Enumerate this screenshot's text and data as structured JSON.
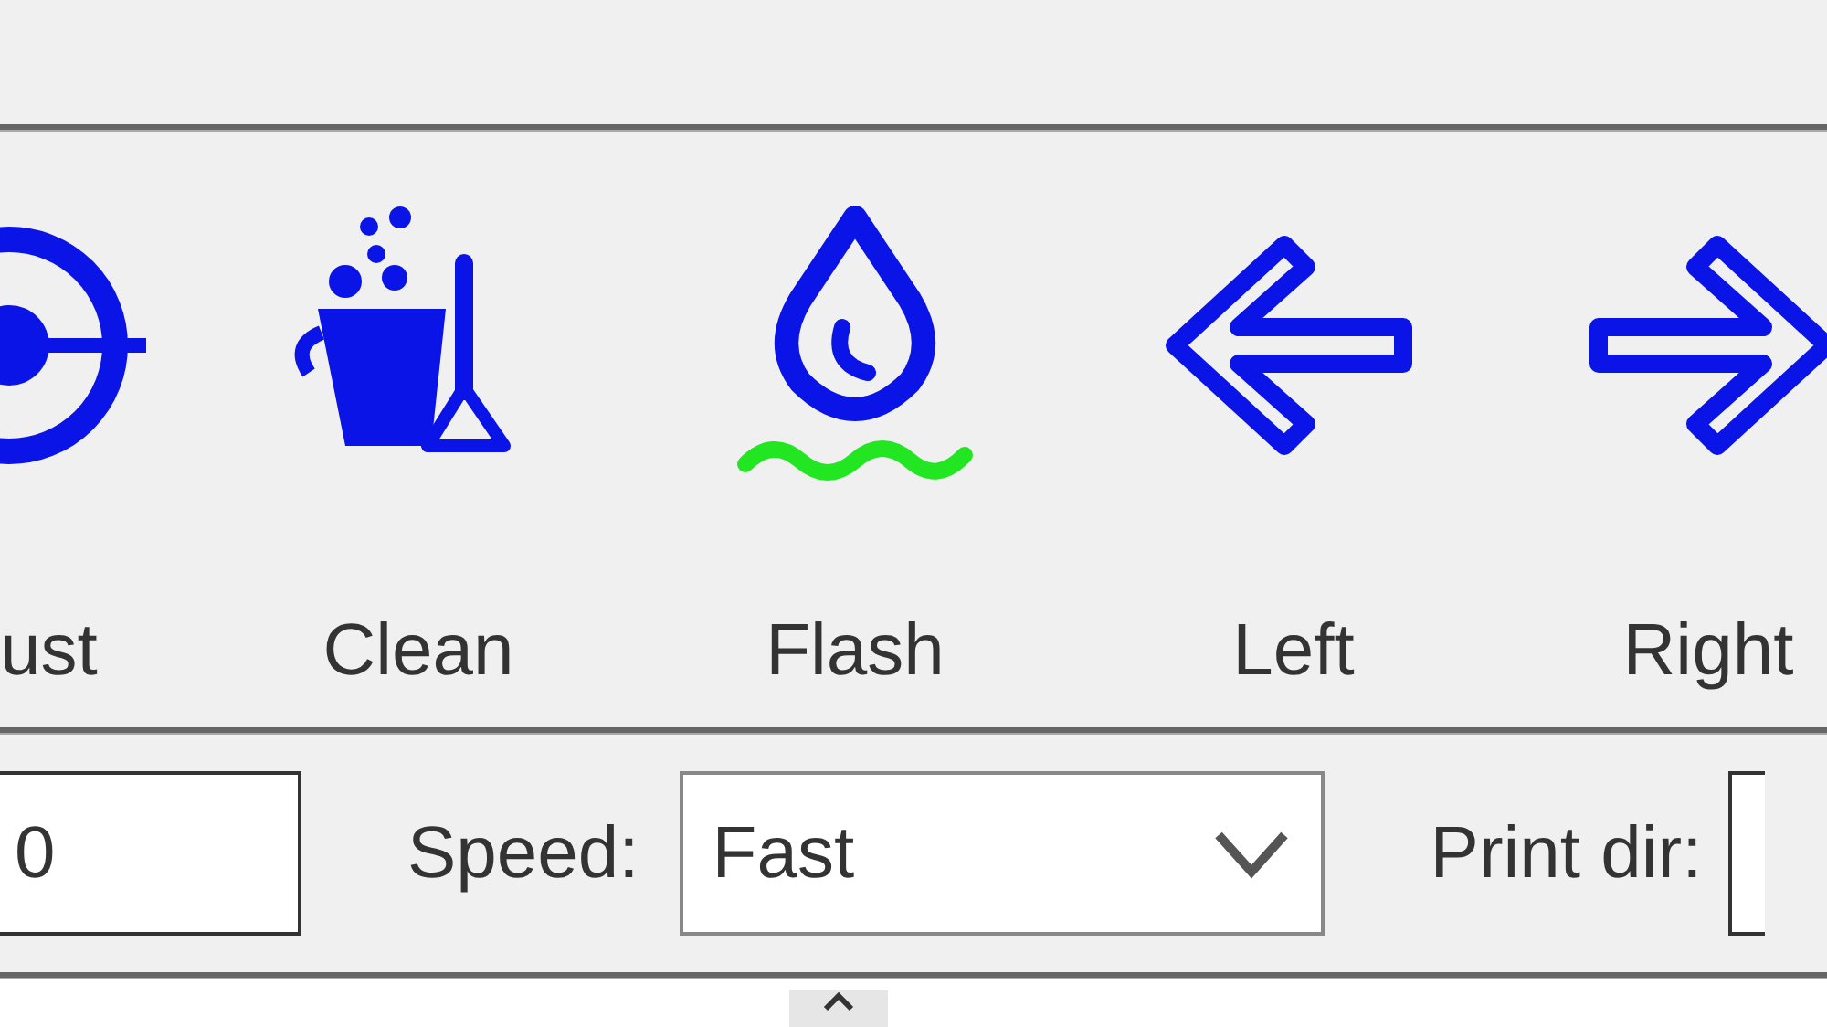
{
  "toolbar": {
    "buttons": [
      {
        "kind": "target",
        "label": "ust"
      },
      {
        "kind": "clean",
        "label": "Clean"
      },
      {
        "kind": "flash",
        "label": "Flash"
      },
      {
        "kind": "left",
        "label": "Left"
      },
      {
        "kind": "right",
        "label": "Right"
      }
    ]
  },
  "settings": {
    "offset_value": "0",
    "speed": {
      "label": "Speed:",
      "value": "Fast"
    },
    "print_dir": {
      "label": "Print dir:"
    }
  }
}
